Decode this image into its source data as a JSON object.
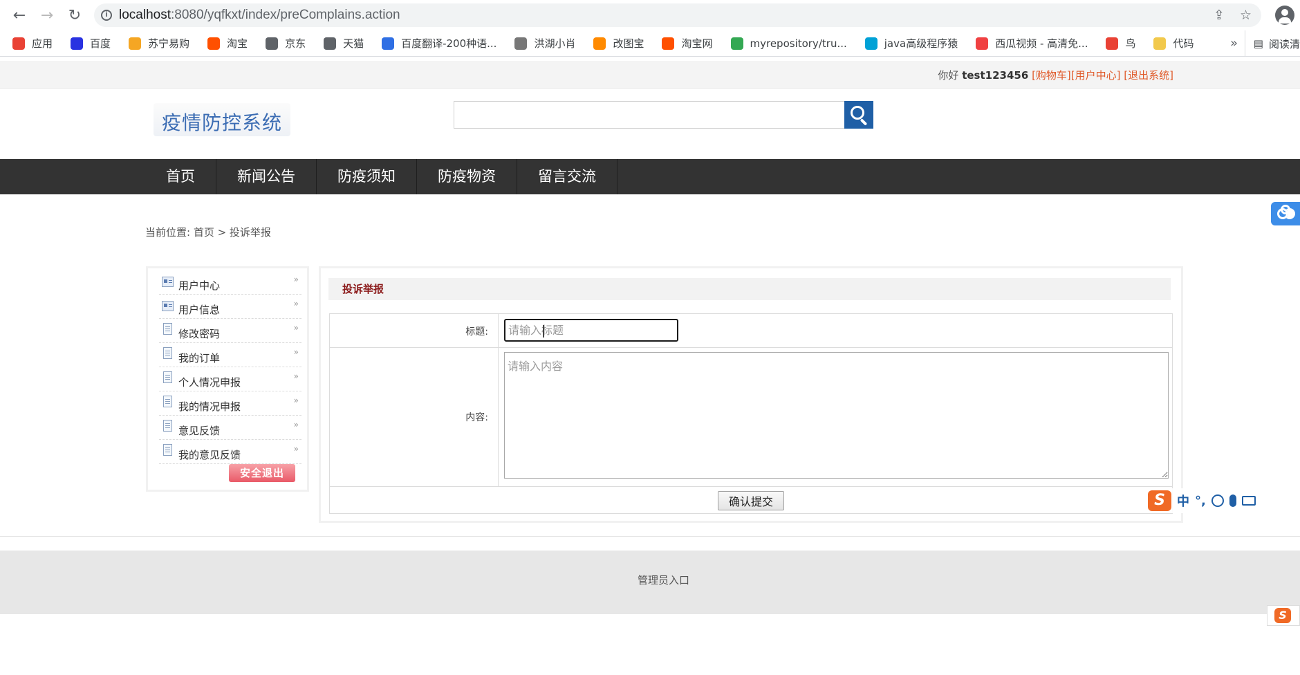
{
  "browser": {
    "url_host": "localhost",
    "url_path": ":8080/yqfkxt/index/preComplains.action",
    "bookmarks": [
      {
        "label": "应用",
        "color": "#e94235"
      },
      {
        "label": "百度",
        "color": "#2932e1"
      },
      {
        "label": "苏宁易购",
        "color": "#f5a623"
      },
      {
        "label": "淘宝",
        "color": "#ff5000"
      },
      {
        "label": "京东",
        "color": "#5f6368"
      },
      {
        "label": "天猫",
        "color": "#5f6368"
      },
      {
        "label": "百度翻译-200种语...",
        "color": "#2f6fe4"
      },
      {
        "label": "洪湖小肖",
        "color": "#777777"
      },
      {
        "label": "改图宝",
        "color": "#ff8a00"
      },
      {
        "label": "淘宝网",
        "color": "#ff5000"
      },
      {
        "label": "myrepository/tru...",
        "color": "#34a853"
      },
      {
        "label": "java高级程序猿",
        "color": "#00a1d6"
      },
      {
        "label": "西瓜视频 - 高清免...",
        "color": "#f04142"
      },
      {
        "label": "鸟",
        "color": "#e94235"
      },
      {
        "label": "代码",
        "color": "#f2c94c"
      }
    ],
    "more": "»",
    "reading_list": "阅读清"
  },
  "topbar": {
    "greeting": "你好",
    "username": "test123456",
    "cart": "[购物车]",
    "user_center": "[用户中心]",
    "logout": "[退出系统]"
  },
  "header": {
    "logo_text": "疫情防控系统",
    "search_placeholder": ""
  },
  "nav": {
    "items": [
      "首页",
      "新闻公告",
      "防疫须知",
      "防疫物资",
      "留言交流"
    ]
  },
  "breadcrumb": "当前位置: 首页 > 投诉举报",
  "sidebar": {
    "items": [
      {
        "label": "用户中心",
        "icon": "card-icon"
      },
      {
        "label": "用户信息",
        "icon": "card-icon"
      },
      {
        "label": "修改密码",
        "icon": "document-icon"
      },
      {
        "label": "我的订单",
        "icon": "document-icon"
      },
      {
        "label": "个人情况申报",
        "icon": "document-icon"
      },
      {
        "label": "我的情况申报",
        "icon": "document-icon"
      },
      {
        "label": "意见反馈",
        "icon": "document-icon"
      },
      {
        "label": "我的意见反馈",
        "icon": "document-icon"
      }
    ],
    "logout_button": "安全退出"
  },
  "form": {
    "title": "投诉举报",
    "title_label": "标题:",
    "title_placeholder": "请输入标题",
    "content_label": "内容:",
    "content_placeholder": "请输入内容",
    "submit_label": "确认提交"
  },
  "ime": {
    "brand": "S",
    "mode": "中",
    "punct": "°,"
  },
  "footer": {
    "admin_link": "管理员入口"
  }
}
